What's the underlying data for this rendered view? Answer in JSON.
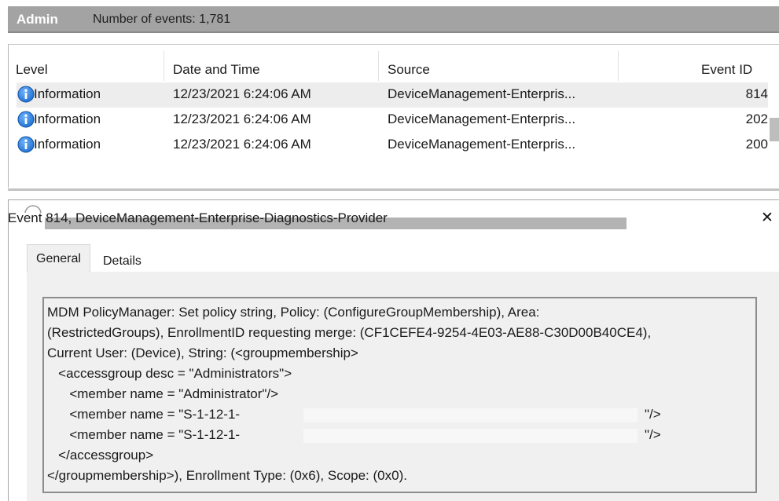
{
  "header": {
    "title": "Admin",
    "event_count": "Number of events: 1,781"
  },
  "list": {
    "columns": [
      "Level",
      "Date and Time",
      "Source",
      "Event ID"
    ],
    "rows": [
      {
        "level": "Information",
        "datetime": "12/23/2021 6:24:06 AM",
        "source": "DeviceManagement-Enterpris...",
        "event_id": "814",
        "selected": true
      },
      {
        "level": "Information",
        "datetime": "12/23/2021 6:24:06 AM",
        "source": "DeviceManagement-Enterpris...",
        "event_id": "202",
        "selected": false
      },
      {
        "level": "Information",
        "datetime": "12/23/2021 6:24:06 AM",
        "source": "DeviceManagement-Enterpris...",
        "event_id": "200",
        "selected": false
      }
    ],
    "level_icon": "information-icon"
  },
  "detail": {
    "title": "Event 814, DeviceManagement-Enterprise-Diagnostics-Provider",
    "close_icon": "close-icon",
    "tabs": [
      {
        "label": "General",
        "active": true
      },
      {
        "label": "Details",
        "active": false
      }
    ],
    "message_lines": [
      "MDM PolicyManager: Set policy string, Policy: (ConfigureGroupMembership), Area:",
      "(RestrictedGroups), EnrollmentID requesting merge: (CF1CEFE4-9254-4E03-AE88-C30D00B40CE4),",
      "Current User: (Device), String: (<groupmembership>",
      "   <accessgroup desc = \"Administrators\">",
      "      <member name = \"Administrator\"/>",
      "      <member name = \"S-1-12-1-",
      "      <member name = \"S-1-12-1-",
      "   </accessgroup>",
      "</groupmembership>), Enrollment Type: (0x6), Scope: (0x0)."
    ],
    "line_tail": "\"/>"
  },
  "colors": {
    "header_bg": "#a3a3a3",
    "selected_row": "#ededed",
    "info_blue": "#1e6fd0",
    "panel_bg": "#f0f0f0"
  }
}
